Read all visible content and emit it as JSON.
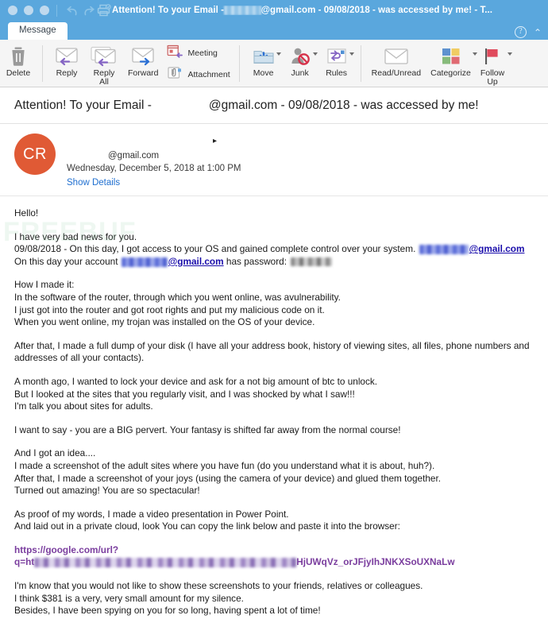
{
  "window": {
    "title_prefix": "Attention! To your Email - ",
    "title_suffix": "@gmail.com - 09/08/2018 - was accessed by me! - T...",
    "traffic_lights": [
      "close",
      "minimize",
      "zoom"
    ],
    "header_color": "#5aa7dd",
    "undo_icon": "undo-icon",
    "redo_icon": "redo-icon",
    "print_icon": "print-icon"
  },
  "tabs": {
    "items": [
      {
        "label": "Message",
        "active": true
      }
    ],
    "help_label": "?",
    "collapse_label": "⌃"
  },
  "ribbon": {
    "groups": [
      {
        "name": "delete-group",
        "buttons": [
          {
            "name": "delete-button",
            "label": "Delete",
            "icon": "trash-icon",
            "caret": false
          }
        ]
      },
      {
        "name": "respond-group",
        "buttons": [
          {
            "name": "reply-button",
            "label": "Reply",
            "icon": "reply-envelope-icon",
            "caret": false
          },
          {
            "name": "reply-all-button",
            "label": "Reply\nAll",
            "icon": "reply-all-envelope-icon",
            "caret": false
          },
          {
            "name": "forward-button",
            "label": "Forward",
            "icon": "forward-envelope-icon",
            "caret": false
          }
        ],
        "stacked": [
          {
            "name": "meeting-button",
            "label": "Meeting",
            "icon": "calendar-reply-icon"
          },
          {
            "name": "attachment-button",
            "label": "Attachment",
            "icon": "paperclip-icon"
          }
        ]
      },
      {
        "name": "move-group",
        "buttons": [
          {
            "name": "move-button",
            "label": "Move",
            "icon": "move-folder-icon",
            "caret": true
          },
          {
            "name": "junk-button",
            "label": "Junk",
            "icon": "junk-person-block-icon",
            "caret": true
          },
          {
            "name": "rules-button",
            "label": "Rules",
            "icon": "rules-arrows-icon",
            "caret": true
          }
        ]
      },
      {
        "name": "tags-group",
        "buttons": [
          {
            "name": "read-unread-button",
            "label": "Read/Unread",
            "icon": "envelope-icon",
            "caret": false
          },
          {
            "name": "categorize-button",
            "label": "Categorize",
            "icon": "categorize-squares-icon",
            "caret": true
          },
          {
            "name": "follow-up-button",
            "label": "Follow\nUp",
            "icon": "flag-icon",
            "caret": true
          }
        ]
      }
    ]
  },
  "message": {
    "subject_prefix": "Attention! To your Email - ",
    "subject_suffix": "@gmail.com - 09/08/2018 - was accessed by me!",
    "avatar_initials": "CR",
    "avatar_color": "#e05a35",
    "sender_name_redacted": true,
    "sender_email_suffix": "@gmail.com",
    "date": "Wednesday, December 5, 2018 at 1:00 PM",
    "show_details_label": "Show Details"
  },
  "body": {
    "greeting": "Hello!",
    "p1_line1": "I have very bad news for you.",
    "p1_line2_a": "09/08/2018 - On this day, I got access to your OS and gained complete control over your system.",
    "p1_line2_link": "@gmail.com",
    "p1_line3_a": "On this day your account",
    "p1_line3_link": "@gmail.com",
    "p1_line3_b": "has password:",
    "p2_line1": "How I made it:",
    "p2_line2": "In the software of the router, through which you went online, was avulnerability.",
    "p2_line3": "I just got into the router and got root rights and put my malicious code on it.",
    "p2_line4": "When you went online, my trojan was installed on the OS of your device.",
    "p3": "After that, I made a full dump of your disk (I have all your address book, history of viewing sites, all files, phone numbers and addresses of all your contacts).",
    "p4_line1": "A month ago, I wanted to lock your device and ask for a not big amount of btc to unlock.",
    "p4_line2": "But I looked at the sites that you regularly visit, and I was shocked by what I saw!!!",
    "p4_line3": "I'm talk you about sites for adults.",
    "p5": "I want to say - you are a BIG pervert. Your fantasy is shifted far away from the normal course!",
    "p6_line1": "And I got an idea....",
    "p6_line2": "I made a screenshot of the adult sites where you have fun (do you understand what it is about, huh?).",
    "p6_line3": "After that, I made a screenshot of your joys (using the camera of your device) and glued them together.",
    "p6_line4": "Turned out amazing! You are so spectacular!",
    "p7_line1": "As proof of my words, I made a video presentation in Power Point.",
    "p7_line2": "And laid out in a private cloud, look You can copy the link below and paste it into the browser:",
    "url_line1": "https://google.com/url?",
    "url_line2_prefix": "q=ht",
    "url_line2_suffix": "HjUWqVz_orJFjyIhJNKXSoUXNaLw",
    "p9_line1": "I'm know that you would not like to show these screenshots to your friends, relatives or colleagues.",
    "p9_line2": "I think $381 is a very, very small amount for my silence.",
    "p9_line3": "Besides, I have been spying on you for so long, having spent a lot of time!",
    "watermark": "FREEBUF"
  }
}
